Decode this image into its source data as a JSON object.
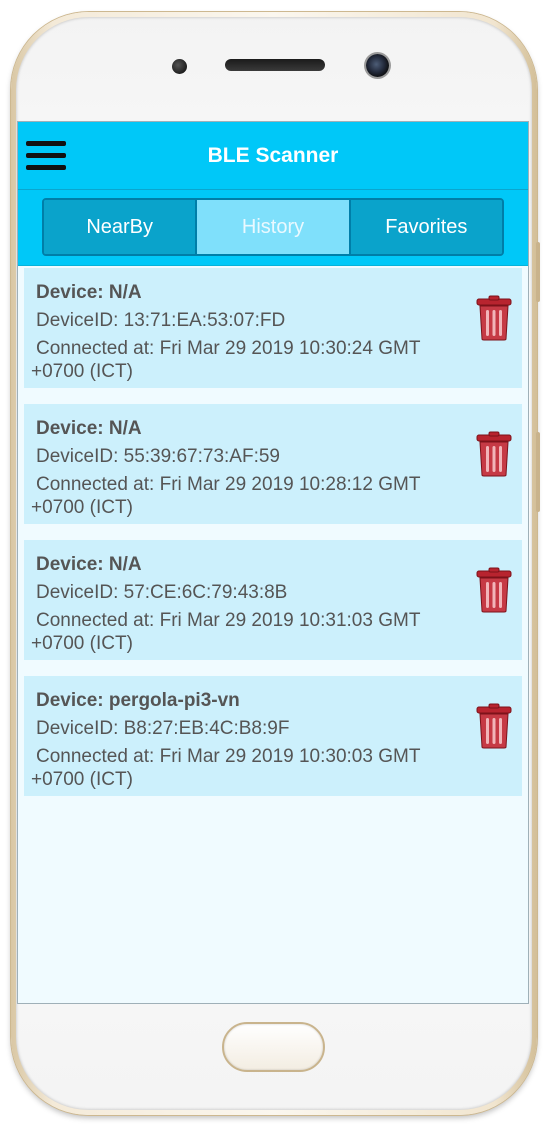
{
  "app": {
    "title": "BLE Scanner"
  },
  "tabs": [
    {
      "label": "NearBy",
      "active": false
    },
    {
      "label": "History",
      "active": true
    },
    {
      "label": "Favorites",
      "active": false
    }
  ],
  "history": [
    {
      "device": "Device: N/A",
      "device_id": "DeviceID: 13:71:EA:53:07:FD",
      "connected_line1": "Connected at: Fri Mar 29 2019 10:30:24 GMT",
      "connected_line2": "+0700 (ICT)"
    },
    {
      "device": "Device: N/A",
      "device_id": "DeviceID: 55:39:67:73:AF:59",
      "connected_line1": "Connected at: Fri Mar 29 2019 10:28:12 GMT",
      "connected_line2": "+0700 (ICT)"
    },
    {
      "device": "Device: N/A",
      "device_id": "DeviceID: 57:CE:6C:79:43:8B",
      "connected_line1": "Connected at: Fri Mar 29 2019 10:31:03 GMT",
      "connected_line2": "+0700 (ICT)"
    },
    {
      "device": "Device: pergola-pi3-vn",
      "device_id": "DeviceID: B8:27:EB:4C:B8:9F",
      "connected_line1": "Connected at: Fri Mar 29 2019 10:30:03 GMT",
      "connected_line2": "+0700 (ICT)"
    }
  ],
  "icons": {
    "menu": "hamburger-menu-icon",
    "delete": "trash-icon"
  },
  "colors": {
    "app_bar": "#00c8f8",
    "tab_active": "#7fe0fb",
    "tab_inactive": "#0aa3cb",
    "item_background": "#ccf0fc",
    "trash": "#c0333d"
  }
}
